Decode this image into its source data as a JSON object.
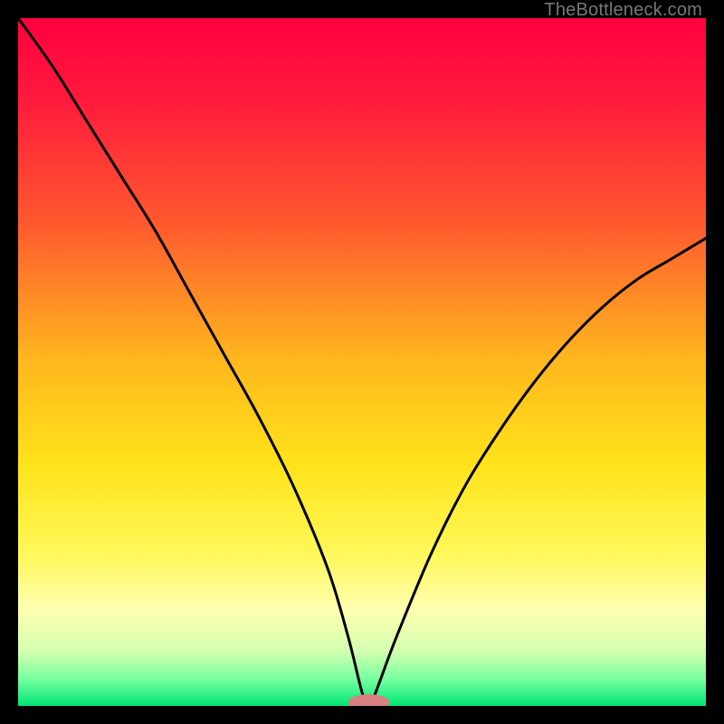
{
  "watermark": "TheBottleneck.com",
  "chart_data": {
    "type": "line",
    "title": "",
    "xlabel": "",
    "ylabel": "",
    "xlim": [
      0,
      100
    ],
    "ylim": [
      0,
      100
    ],
    "gradient_stops": [
      {
        "offset": 0,
        "color": "#ff0040"
      },
      {
        "offset": 12,
        "color": "#ff1a3c"
      },
      {
        "offset": 30,
        "color": "#ff5a2e"
      },
      {
        "offset": 50,
        "color": "#ffb81e"
      },
      {
        "offset": 65,
        "color": "#ffe31a"
      },
      {
        "offset": 78,
        "color": "#fff85a"
      },
      {
        "offset": 86,
        "color": "#ffffb0"
      },
      {
        "offset": 92,
        "color": "#d4ffb0"
      },
      {
        "offset": 96,
        "color": "#7affa0"
      },
      {
        "offset": 100,
        "color": "#00e676"
      }
    ],
    "series": [
      {
        "name": "bottleneck-curve",
        "x": [
          0,
          5,
          10,
          15,
          20,
          25,
          30,
          35,
          40,
          45,
          48,
          50,
          51,
          52,
          55,
          60,
          65,
          70,
          75,
          80,
          85,
          90,
          95,
          100
        ],
        "y": [
          100,
          93,
          85,
          77,
          69,
          60,
          51,
          42,
          32,
          20,
          10,
          2,
          0,
          2,
          10,
          22,
          32,
          40,
          47,
          53,
          58,
          62,
          65,
          68
        ]
      }
    ],
    "marker": {
      "x": 51,
      "y": 0.5,
      "rx": 3.0,
      "ry": 1.2,
      "color": "#d98080"
    }
  }
}
